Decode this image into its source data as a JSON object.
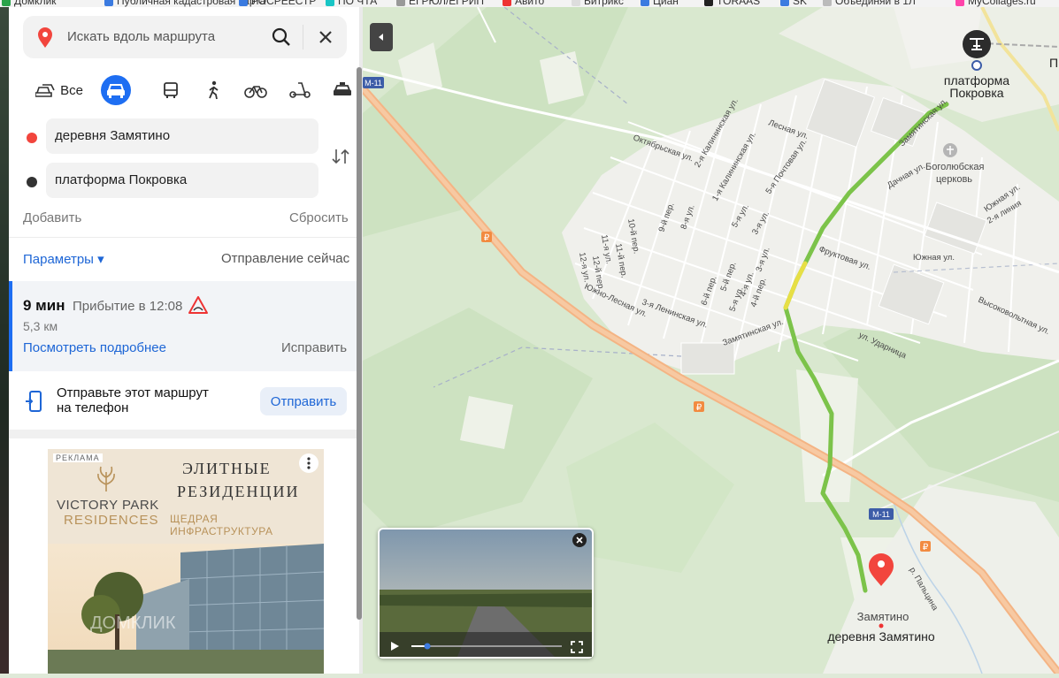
{
  "bookmarks": [
    "Домклик",
    "Публичная кадастровая карта",
    "РОСРЕЕСТР",
    "ПО ЧТА",
    "ЕГРЮЛ/ЕГРИП",
    "Авито",
    "Битрикс",
    "Циан",
    "TORAAS",
    "SK",
    "Объединяй в 1Л",
    "MyCollages.ru"
  ],
  "search": {
    "placeholder": "Искать вдоль маршрута"
  },
  "modes": {
    "all_label": "Все"
  },
  "route": {
    "from": "деревня Замятино",
    "to": "платформа Покровка",
    "add_label": "Добавить",
    "reset_label": "Сбросить",
    "params_label": "Параметры ▾",
    "departure_label": "Отправление сейчас"
  },
  "result": {
    "time": "9 мин",
    "arrival": "Прибытие в 12:08",
    "distance": "5,3 км",
    "details_label": "Посмотреть подробнее",
    "fix_label": "Исправить"
  },
  "send": {
    "text_line1": "Отправьте этот маршрут",
    "text_line2": "на телефон",
    "button_label": "Отправить"
  },
  "ad": {
    "tag": "РЕКЛАМА",
    "brand_line1": "VICTORY PARK",
    "brand_line2": "RESIDENCES",
    "headline1": "ЭЛИТНЫЕ",
    "headline2": "РЕЗИДЕНЦИИ",
    "headline3": "ЩЕДРАЯ ИНФРАСТРУКТУРА",
    "watermark": "ДОМКЛИК"
  },
  "map": {
    "highway": "М-11",
    "start_place": "Замятино",
    "start_label": "деревня Замятино",
    "end_label_line1": "платформа",
    "end_label_line2": "Покровка",
    "church_line1": "Боголюбская",
    "church_line2": "церковь",
    "edge_letter": "П",
    "streets": [
      "Октябрьская ул.",
      "2-я Калининская ул.",
      "Лесная ул.",
      "1-я Калининская ул.",
      "5-я Почтовая ул.",
      "Замятинская ул.",
      "Дачная ул.",
      "Южная ул.",
      "2-я линия",
      "Фруктовая ул.",
      "Южная ул.",
      "Высоковольтная ул.",
      "ул. Ударница",
      "Южно-Лесная ул.",
      "3-я Ленинская ул.",
      "10-й пер.",
      "9-й пер.",
      "8-я ул.",
      "11-я ул.",
      "11-й пер.",
      "12-я ул.",
      "12-й пер.",
      "5-я ул.",
      "3-я ул.",
      "6-й пер.",
      "5-й пер.",
      "5-я ул.",
      "4-я ул.",
      "4-й пер.",
      "3-я ул.",
      "р. Пальцина"
    ]
  }
}
